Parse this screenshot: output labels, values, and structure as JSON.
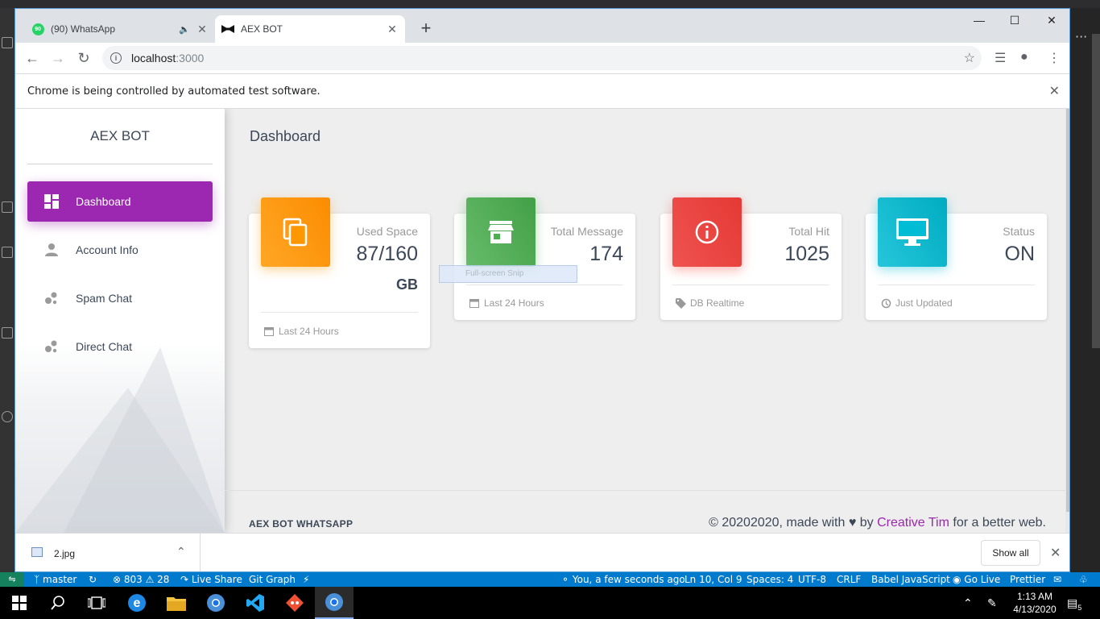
{
  "browser": {
    "tabs": [
      {
        "label": "(90) WhatsApp",
        "badge": "90"
      },
      {
        "label": "AEX BOT"
      }
    ],
    "url_host": "localhost",
    "url_port": ":3000",
    "automation_notice": "Chrome is being controlled by automated test software."
  },
  "sidebar": {
    "brand": "AEX BOT",
    "items": [
      {
        "label": "Dashboard",
        "icon": "dashboard-icon"
      },
      {
        "label": "Account Info",
        "icon": "person-icon"
      },
      {
        "label": "Spam Chat",
        "icon": "bubble-chart-icon"
      },
      {
        "label": "Direct Chat",
        "icon": "bubble-chart-icon"
      }
    ]
  },
  "main": {
    "title": "Dashboard",
    "cards": [
      {
        "category": "Used Space",
        "value": "87/160",
        "unit": "GB",
        "footer": "Last 24 Hours",
        "color": "#ff9800",
        "icon": "content-copy-icon",
        "footer_icon": "calendar-icon"
      },
      {
        "category": "Total Message",
        "value": "174",
        "footer": "Last 24 Hours",
        "color": "#4caf50",
        "icon": "store-icon",
        "footer_icon": "calendar-icon"
      },
      {
        "category": "Total Hit",
        "value": "1025",
        "footer": "DB Realtime",
        "color": "#f44336",
        "icon": "info-outline-icon",
        "footer_icon": "tag-icon"
      },
      {
        "category": "Status",
        "value": "ON",
        "footer": "Just Updated",
        "color": "#00bcd4",
        "icon": "desktop-icon",
        "footer_icon": "update-icon"
      }
    ],
    "snip_overlay": "Full-screen Snip"
  },
  "footer": {
    "left": "AEX BOT WHATSAPP",
    "right_prefix": "© 20202020, made with",
    "right_by": "by",
    "right_link": "Creative Tim",
    "right_suffix": "for a better web."
  },
  "downloads": {
    "file": "2.jpg",
    "show_all": "Show all"
  },
  "vscode_status": {
    "branch": "master",
    "errors": "803",
    "warnings": "28",
    "live_share": "Live Share",
    "git_graph": "Git Graph",
    "blame": "You, a few seconds ago",
    "position": "Ln 10, Col 9",
    "spaces": "Spaces: 4",
    "encoding": "UTF-8",
    "eol": "CRLF",
    "language": "Babel JavaScript",
    "go_live": "Go Live",
    "prettier": "Prettier"
  },
  "taskbar": {
    "time": "1:13 AM",
    "date": "4/13/2020",
    "notifications": "5"
  },
  "colors": {
    "accent": "#9c27b0",
    "vscode_blue": "#007acc"
  }
}
